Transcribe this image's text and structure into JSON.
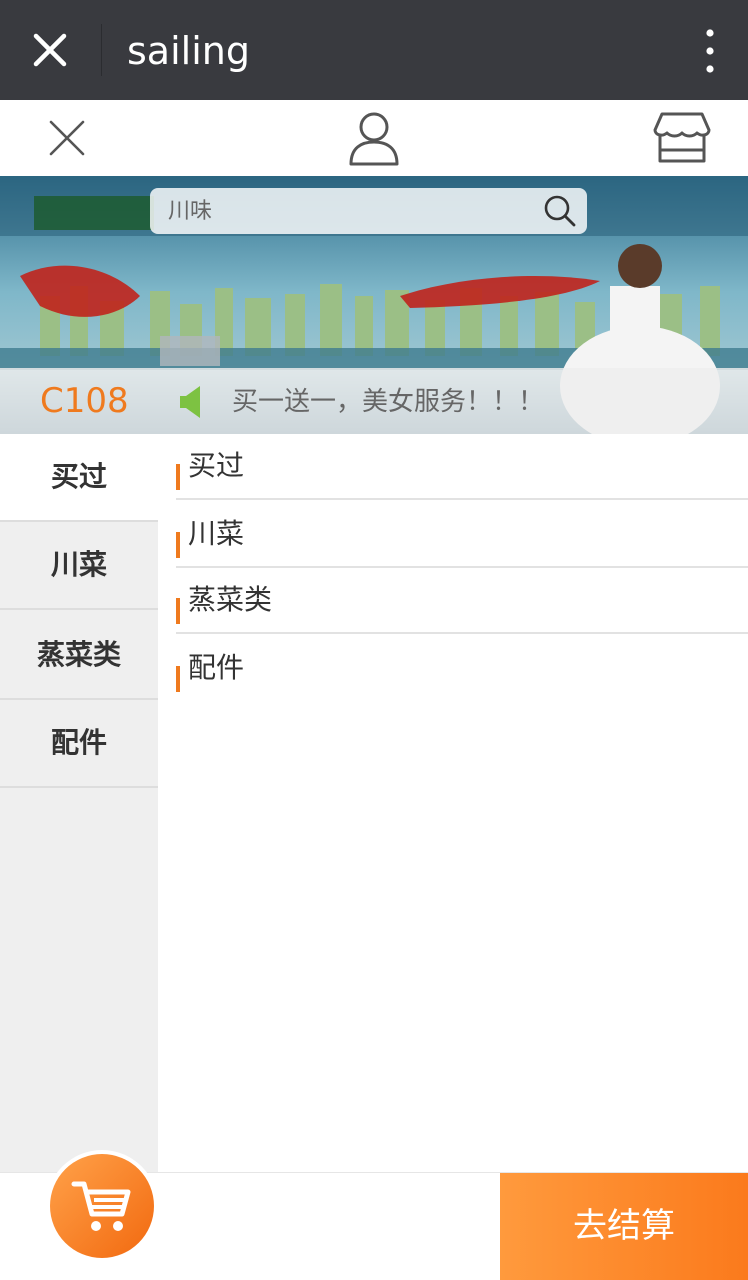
{
  "window": {
    "title": "sailing"
  },
  "search": {
    "placeholder": "川味"
  },
  "notice": {
    "table_no": "C108",
    "text": "买一送一，美女服务！！！"
  },
  "sidebar": {
    "items": [
      {
        "label": "买过",
        "active": true
      },
      {
        "label": "川菜",
        "active": false
      },
      {
        "label": "蒸菜类",
        "active": false
      },
      {
        "label": "配件",
        "active": false
      }
    ]
  },
  "content": {
    "categories": [
      {
        "label": "买过"
      },
      {
        "label": "川菜"
      },
      {
        "label": "蒸菜类"
      },
      {
        "label": "配件"
      }
    ]
  },
  "bottom": {
    "checkout_label": "去结算"
  },
  "colors": {
    "accent": "#ef7a1e",
    "titlebar": "#393a3f",
    "sidebar_bg": "#efefef",
    "speaker": "#7dc242"
  }
}
